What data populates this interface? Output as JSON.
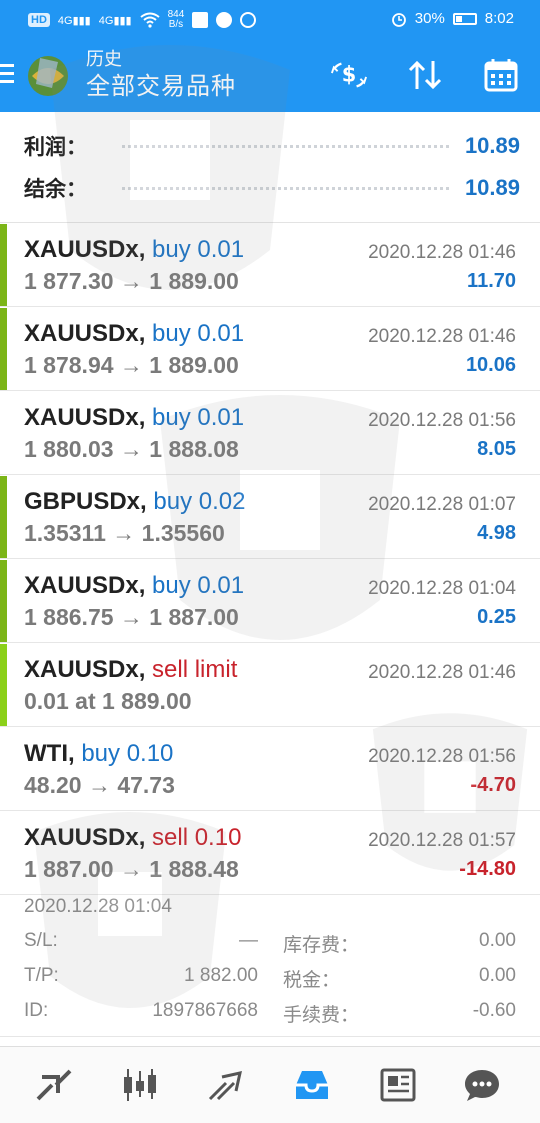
{
  "status_bar": {
    "network_left": "HD",
    "signal_1": "4G",
    "signal_2": "4G",
    "speed_value": "844",
    "speed_unit": "B/s",
    "battery": "30%",
    "time": "8:02"
  },
  "header": {
    "title_small": "历史",
    "title_large": "全部交易品种",
    "actions": [
      "exchange-dollar-icon",
      "sort-arrows-icon",
      "calendar-icon"
    ],
    "colors": {
      "bar_bg": "#2196f3"
    }
  },
  "summary": {
    "profit_label": "利润：",
    "profit_value": "10.89",
    "balance_label": "结余：",
    "balance_value": "10.89"
  },
  "trades": [
    {
      "symbol": "XAUUSDx,",
      "side": "buy 0.01",
      "side_color": "blue",
      "prices": "1 877.30 → 1 889.00",
      "time": "2020.12.28 01:46",
      "profit": "11.70",
      "profit_color": "blue",
      "bar_color": "#7cb518"
    },
    {
      "symbol": "XAUUSDx,",
      "side": "buy 0.01",
      "side_color": "blue",
      "prices": "1 878.94 → 1 889.00",
      "time": "2020.12.28 01:46",
      "profit": "10.06",
      "profit_color": "blue",
      "bar_color": "#7cb518"
    },
    {
      "symbol": "XAUUSDx,",
      "side": "buy 0.01",
      "side_color": "blue",
      "prices": "1 880.03 → 1 888.08",
      "time": "2020.12.28 01:56",
      "profit": "8.05",
      "profit_color": "blue",
      "bar_color": ""
    },
    {
      "symbol": "GBPUSDx,",
      "side": "buy 0.02",
      "side_color": "blue",
      "prices": "1.35311 → 1.35560",
      "time": "2020.12.28 01:07",
      "profit": "4.98",
      "profit_color": "blue",
      "bar_color": "#7cb518"
    },
    {
      "symbol": "XAUUSDx,",
      "side": "buy 0.01",
      "side_color": "blue",
      "prices": "1 886.75 → 1 887.00",
      "time": "2020.12.28 01:04",
      "profit": "0.25",
      "profit_color": "blue",
      "bar_color": "#7cb518"
    },
    {
      "symbol": "XAUUSDx,",
      "side": "sell limit",
      "side_color": "red",
      "prices": "0.01 at 1 889.00",
      "time": "2020.12.28 01:46",
      "profit": "",
      "profit_color": "blue",
      "bar_color": "#8bd01a"
    },
    {
      "symbol": "WTI,",
      "side": "buy 0.10",
      "side_color": "blue",
      "prices": "48.20 → 47.73",
      "time": "2020.12.28 01:56",
      "profit": "-4.70",
      "profit_color": "red",
      "bar_color": ""
    },
    {
      "symbol": "XAUUSDx,",
      "side": "sell 0.10",
      "side_color": "red",
      "prices": "1 887.00 → 1 888.48",
      "time": "2020.12.28 01:57",
      "profit": "-14.80",
      "profit_color": "red",
      "bar_color": ""
    }
  ],
  "detail": {
    "open_time": "2020.12.28 01:04",
    "sl_label": "S/L:",
    "sl_value": "—",
    "swap_label": "库存费：",
    "swap_value": "0.00",
    "tp_label": "T/P:",
    "tp_value": "1 882.00",
    "tax_label": "税金：",
    "tax_value": "0.00",
    "id_label": "ID:",
    "id_value": "1897867668",
    "commission_label": "手续费：",
    "commission_value": "-0.60"
  },
  "bottom_nav": [
    "quotes-icon",
    "chart-icon",
    "trade-icon",
    "history-icon",
    "news-icon",
    "chat-icon"
  ]
}
